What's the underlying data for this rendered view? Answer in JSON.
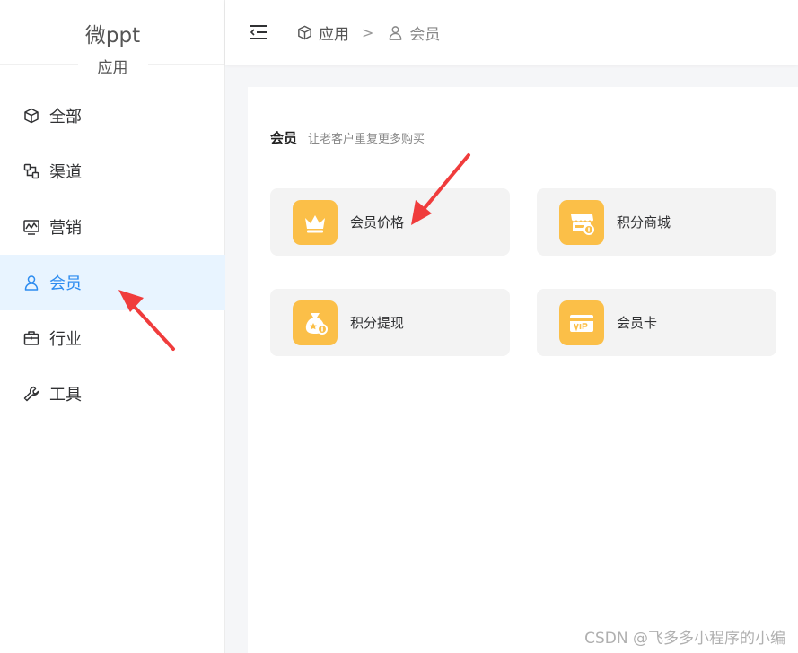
{
  "brand": {
    "name": "微ppt",
    "sub": "应用"
  },
  "sidebar": {
    "items": [
      {
        "label": "全部",
        "icon": "cube-icon",
        "active": false
      },
      {
        "label": "渠道",
        "icon": "channel-icon",
        "active": false
      },
      {
        "label": "营销",
        "icon": "chart-monitor-icon",
        "active": false
      },
      {
        "label": "会员",
        "icon": "user-icon",
        "active": true
      },
      {
        "label": "行业",
        "icon": "briefcase-icon",
        "active": false
      },
      {
        "label": "工具",
        "icon": "wrench-icon",
        "active": false
      }
    ]
  },
  "breadcrumb": {
    "root": "应用",
    "separator": ">",
    "current": "会员"
  },
  "section": {
    "title": "会员",
    "desc": "让老客户重复更多购买"
  },
  "tiles": [
    {
      "label": "会员价格",
      "icon": "crown-icon"
    },
    {
      "label": "积分商城",
      "icon": "store-coin-icon"
    },
    {
      "label": "积分提现",
      "icon": "money-bag-icon"
    },
    {
      "label": "会员卡",
      "icon": "vip-card-icon"
    }
  ],
  "colors": {
    "accent": "#2d8cf0",
    "active_bg": "#e8f4ff",
    "tile_icon_bg": "#fbbf48",
    "arrow": "#f03c3c"
  },
  "watermark": "CSDN @飞多多小程序的小编"
}
